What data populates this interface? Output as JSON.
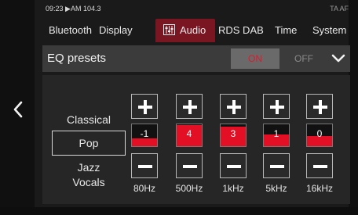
{
  "status": {
    "time_radio": "09:23 ▶AM 104.3",
    "flags": "TA  AF"
  },
  "tabs": [
    {
      "label": "Bluetooth"
    },
    {
      "label": "Display"
    },
    {
      "label": "Audio",
      "active": true
    },
    {
      "label": "RDS DAB"
    },
    {
      "label": "Time"
    },
    {
      "label": "System"
    }
  ],
  "eq": {
    "title": "EQ presets",
    "on_label": "ON",
    "off_label": "OFF",
    "state": "on"
  },
  "presets": [
    {
      "label": "Classical"
    },
    {
      "label": "Pop",
      "selected": true
    },
    {
      "label": "Jazz"
    },
    {
      "label": "Vocals"
    }
  ],
  "bands": [
    {
      "freq": "80Hz",
      "value": "-1",
      "fill_fraction": 0.35
    },
    {
      "freq": "500Hz",
      "value": "4",
      "fill_fraction": 0.95
    },
    {
      "freq": "1kHz",
      "value": "3",
      "fill_fraction": 0.9
    },
    {
      "freq": "5kHz",
      "value": "1",
      "fill_fraction": 0.55
    },
    {
      "freq": "16kHz",
      "value": "0",
      "fill_fraction": 0.45
    }
  ],
  "colors": {
    "accent": "#e30f25",
    "active_tab": "#7a1522"
  },
  "icons": {
    "eq_tab": "equalizer-icon",
    "back": "chevron-left-icon",
    "collapse": "chevron-down-icon",
    "increase": "plus-icon",
    "decrease": "minus-icon"
  }
}
